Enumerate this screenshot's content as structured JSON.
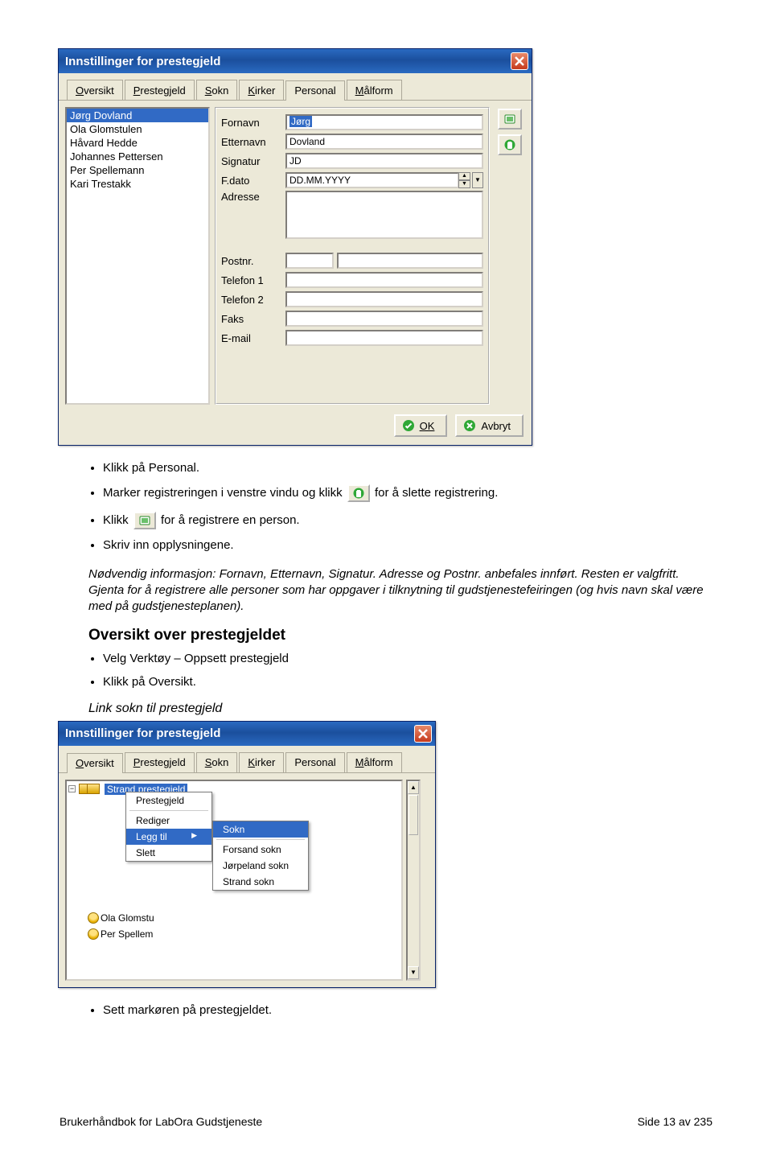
{
  "win1": {
    "title": "Innstillinger for prestegjeld",
    "tabs": [
      "Oversikt",
      "Prestegjeld",
      "Sokn",
      "Kirker",
      "Personal",
      "Målform"
    ],
    "activeTabIndex": 4,
    "people": [
      "Jørg Dovland",
      "Ola Glomstulen",
      "Håvard Hedde",
      "Johannes Pettersen",
      "Per Spellemann",
      "Kari Trestakk"
    ],
    "selectedPersonIndex": 0,
    "form": {
      "labels": {
        "fornavn": "Fornavn",
        "etternavn": "Etternavn",
        "signatur": "Signatur",
        "fdato": "F.dato",
        "adresse": "Adresse",
        "postnr": "Postnr.",
        "tel1": "Telefon 1",
        "tel2": "Telefon 2",
        "faks": "Faks",
        "email": "E-mail"
      },
      "values": {
        "fornavn": "Jørg",
        "etternavn": "Dovland",
        "signatur": "JD",
        "fdato": "DD.MM.YYYY",
        "adresse": "",
        "postnrA": "",
        "postnrB": "",
        "tel1": "",
        "tel2": "",
        "faks": "",
        "email": ""
      }
    },
    "sideIcons": {
      "add": "add-person-icon",
      "delete": "delete-icon"
    },
    "buttons": {
      "ok": "OK",
      "cancel": "Avbryt"
    }
  },
  "body": {
    "b1": "Klikk på Personal.",
    "b2a": "Marker registreringen i venstre vindu og klikk ",
    "b2b": " for å slette registrering.",
    "b3a": "Klikk ",
    "b3b": " for å registrere en person.",
    "b4": "Skriv inn opplysningene.",
    "note": "Nødvendig informasjon: Fornavn, Etternavn, Signatur. Adresse og Postnr. anbefales innført. Resten er valgfritt. Gjenta for å registrere alle personer som har oppgaver i tilknytning til gudstjenestefeiringen (og hvis navn skal være med på gudstjenesteplanen).",
    "subhead": "Oversikt over prestegjeldet",
    "b5": "Velg Verktøy – Oppsett prestegjeld",
    "b6": "Klikk på Oversikt.",
    "ital2": "Link sokn til prestegjeld"
  },
  "win2": {
    "title": "Innstillinger for prestegjeld",
    "tabs": [
      "Oversikt",
      "Prestegjeld",
      "Sokn",
      "Kirker",
      "Personal",
      "Målform"
    ],
    "activeTabIndex": 0,
    "treeTop": "Strand prestegjeld",
    "menu": {
      "items": [
        "Prestegjeld",
        "Rediger",
        "Legg til",
        "Slett"
      ],
      "selectedIndex": 2
    },
    "submenu": {
      "items": [
        "Sokn",
        "Forsand sokn",
        "Jørpeland sokn",
        "Strand sokn"
      ],
      "selectedIndex": 0
    },
    "peopleBelow": [
      "Ola  Glomstu",
      "Per  Spellem"
    ]
  },
  "after": {
    "b7": "Sett markøren på prestegjeldet."
  },
  "footer": {
    "left": "Brukerhåndbok for LabOra Gudstjeneste",
    "right": "Side 13 av 235"
  },
  "colors": {
    "titlebar": "#2a6ac1",
    "select": "#316ac5",
    "panel": "#ece9d8"
  }
}
